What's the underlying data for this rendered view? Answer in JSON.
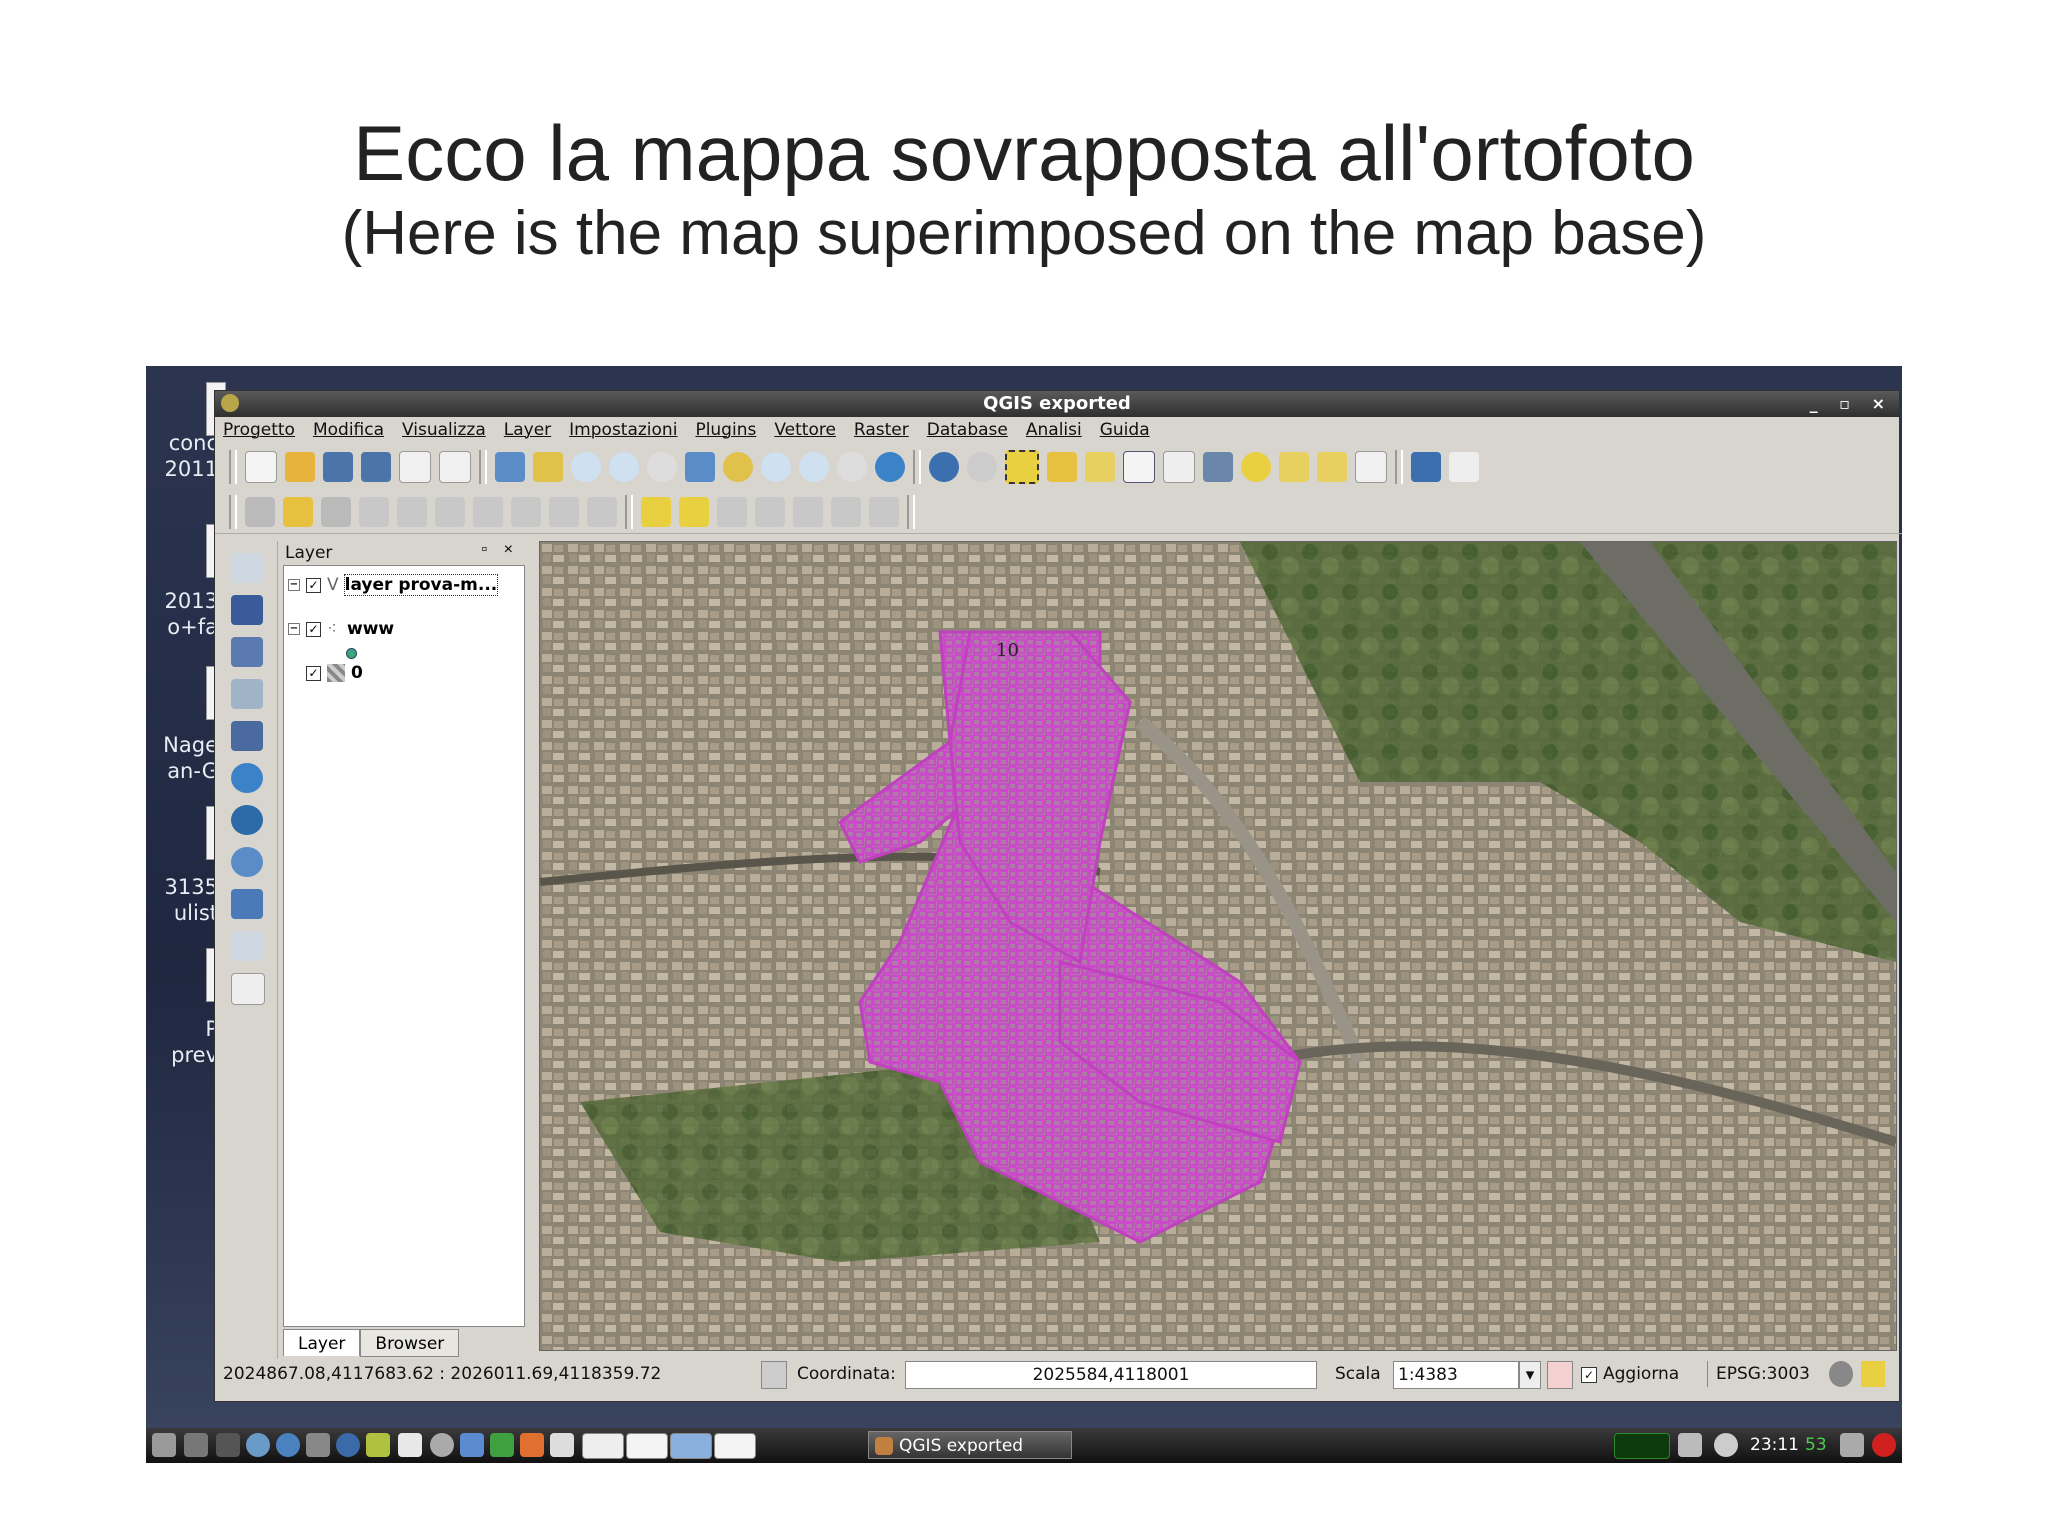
{
  "slide": {
    "title": "Ecco la mappa sovrapposta all'ortofoto",
    "subtitle": "(Here is the map superimposed on the map base)"
  },
  "desktop": {
    "icons": [
      {
        "label": "conc\n2011"
      },
      {
        "label": "2013\no+fa"
      },
      {
        "label": "Nage\nan-G"
      },
      {
        "label": "3135\nulist"
      },
      {
        "label": "P\nprev"
      }
    ]
  },
  "window": {
    "title": "QGIS exported",
    "controls": "_ ▫ ×"
  },
  "menu": [
    "Progetto",
    "Modifica",
    "Visualizza",
    "Layer",
    "Impostazioni",
    "Plugins",
    "Vettore",
    "Raster",
    "Database",
    "Analisi",
    "Guida"
  ],
  "layer_panel": {
    "title": "Layer",
    "controls": "▫ ×",
    "layers": [
      {
        "name": "layer prova-m...",
        "checked": true
      },
      {
        "name": "www",
        "checked": true
      },
      {
        "name": "0",
        "checked": true
      }
    ],
    "tabs": [
      "Layer",
      "Browser"
    ]
  },
  "map": {
    "labels": [
      "10"
    ],
    "overlay_color": "#c04ac0"
  },
  "status": {
    "extent": "2024867.08,4117683.62 : 2026011.69,4118359.72",
    "coord_label": "Coordinata:",
    "coord_value": "2025584,4118001",
    "scale_label": "Scala",
    "scale_value": "1:4383",
    "refresh_label": "Aggiorna",
    "refresh_checked": true,
    "crs": "EPSG:3003"
  },
  "taskbar": {
    "task": "QGIS exported",
    "time": "23:11",
    "seconds": "53"
  }
}
